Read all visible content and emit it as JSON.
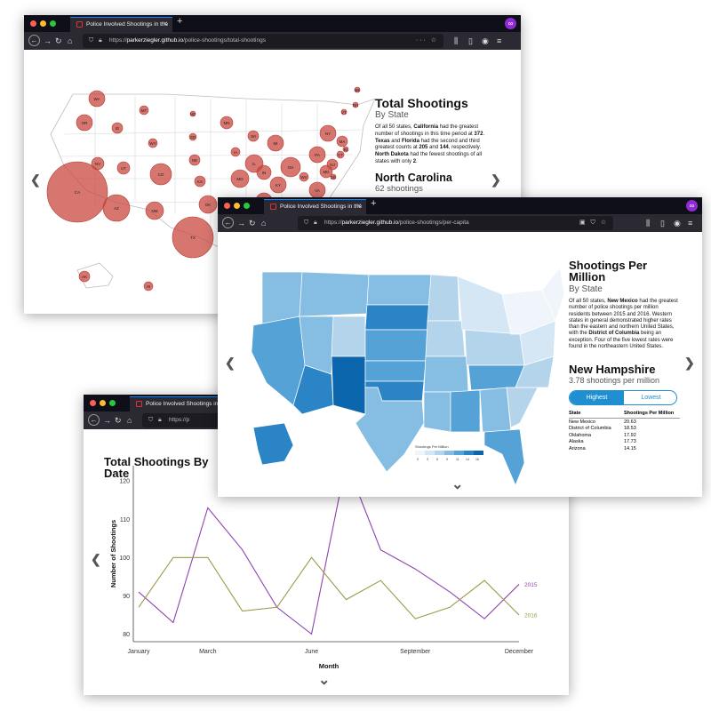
{
  "tab_title": "Police Involved Shootings in the",
  "url_host": "parkerziegler.github.io",
  "win1": {
    "url_prefix": "https://",
    "url_path": "/police-shootings/total-shootings",
    "title": "Total Shootings",
    "subtitle": "By State",
    "para_parts": [
      "Of all 50 states, ",
      "California",
      " had the greatest number of shootings in this time period at ",
      "372",
      ". ",
      "Texas",
      " and ",
      "Florida",
      " had the second and third greatest counts at ",
      "205",
      " and ",
      "144",
      ", respectively. ",
      "North Dakota",
      " had the fewest shootings of all states with only ",
      "2",
      "."
    ],
    "selected_state": "North Carolina",
    "selected_value": "62 shootings",
    "bubbles": [
      {
        "abbr": "WA"
      },
      {
        "abbr": "OR"
      },
      {
        "abbr": "CA"
      },
      {
        "abbr": "NV"
      },
      {
        "abbr": "ID"
      },
      {
        "abbr": "MT"
      },
      {
        "abbr": "WY"
      },
      {
        "abbr": "UT"
      },
      {
        "abbr": "AZ"
      },
      {
        "abbr": "CO"
      },
      {
        "abbr": "NM"
      },
      {
        "abbr": "ND"
      },
      {
        "abbr": "SD"
      },
      {
        "abbr": "NE"
      },
      {
        "abbr": "KS"
      },
      {
        "abbr": "OK"
      },
      {
        "abbr": "TX"
      },
      {
        "abbr": "MN"
      },
      {
        "abbr": "IA"
      },
      {
        "abbr": "MO"
      },
      {
        "abbr": "WI"
      },
      {
        "abbr": "IL"
      },
      {
        "abbr": "MI"
      },
      {
        "abbr": "IN"
      },
      {
        "abbr": "OH"
      },
      {
        "abbr": "KY"
      },
      {
        "abbr": "TN"
      },
      {
        "abbr": "WV"
      },
      {
        "abbr": "VA"
      },
      {
        "abbr": "PA"
      },
      {
        "abbr": "NY"
      },
      {
        "abbr": "VT"
      },
      {
        "abbr": "NH"
      },
      {
        "abbr": "ME"
      },
      {
        "abbr": "MA"
      },
      {
        "abbr": "CT"
      },
      {
        "abbr": "RI"
      },
      {
        "abbr": "NJ"
      },
      {
        "abbr": "DE"
      },
      {
        "abbr": "MD"
      },
      {
        "abbr": "AK"
      },
      {
        "abbr": "HI"
      }
    ]
  },
  "win2": {
    "url_prefix": "https://",
    "url_path": "/police-shootings/per-capita",
    "title_line1": "Shootings Per",
    "title_line2": "Million",
    "subtitle": "By State",
    "para_parts": [
      "Of all 50 states, ",
      "New Mexico",
      " had the greatest number of police shootings per million residents between 2015 and 2016. Western states in general demonstrated higher rates than the eastern and northern United States, with the ",
      "District of Columbia",
      " being an exception. Four of the five lowest rates were found in the northeastern United States."
    ],
    "selected_state": "New Hampshire",
    "selected_value": "3.78 shootings per million",
    "toggle_highest": "Highest",
    "toggle_lowest": "Lowest",
    "table_header_state": "State",
    "table_header_value": "Shootings Per Million",
    "table_rows": [
      {
        "state": "New Mexico",
        "value": "20.63"
      },
      {
        "state": "District of Columbia",
        "value": "18.53"
      },
      {
        "state": "Oklahoma",
        "value": "17.92"
      },
      {
        "state": "Alaska",
        "value": "17.73"
      },
      {
        "state": "Arizona",
        "value": "14.15"
      }
    ],
    "legend_title": "Shootings Per Million",
    "legend_ticks": [
      "0",
      "3",
      "6",
      "9",
      "11",
      "14",
      "16"
    ],
    "legend_colors": [
      "#eff5fb",
      "#d5e7f5",
      "#b4d4ec",
      "#86bde2",
      "#55a2d6",
      "#2a84c6",
      "#0c66ad"
    ]
  },
  "win3": {
    "url_prefix": "https://p",
    "title_line1": "Total Shootings By",
    "title_line2": "Date",
    "chart_data": {
      "type": "line",
      "title": "Total Shootings By Date",
      "xlabel": "Month",
      "ylabel": "Number of Shootings",
      "categories": [
        "January",
        "February",
        "March",
        "April",
        "May",
        "June",
        "July",
        "August",
        "September",
        "October",
        "November",
        "December"
      ],
      "x_tick_labels": [
        "January",
        "March",
        "June",
        "September",
        "December"
      ],
      "y_ticks": [
        80,
        90,
        100,
        110,
        120
      ],
      "ylim": [
        78,
        124
      ],
      "grid": false,
      "series": [
        {
          "name": "2015",
          "color": "#8e44ad",
          "values": [
            91,
            83,
            113,
            102,
            87,
            80,
            125,
            102,
            97,
            91,
            84,
            93
          ]
        },
        {
          "name": "2016",
          "color": "#9a9a4a",
          "values": [
            87,
            100,
            100,
            86,
            87,
            100,
            89,
            94,
            84,
            87,
            94,
            85
          ]
        }
      ]
    }
  },
  "arrow_left": "❮",
  "arrow_right": "❯",
  "arrow_down": "⌄"
}
